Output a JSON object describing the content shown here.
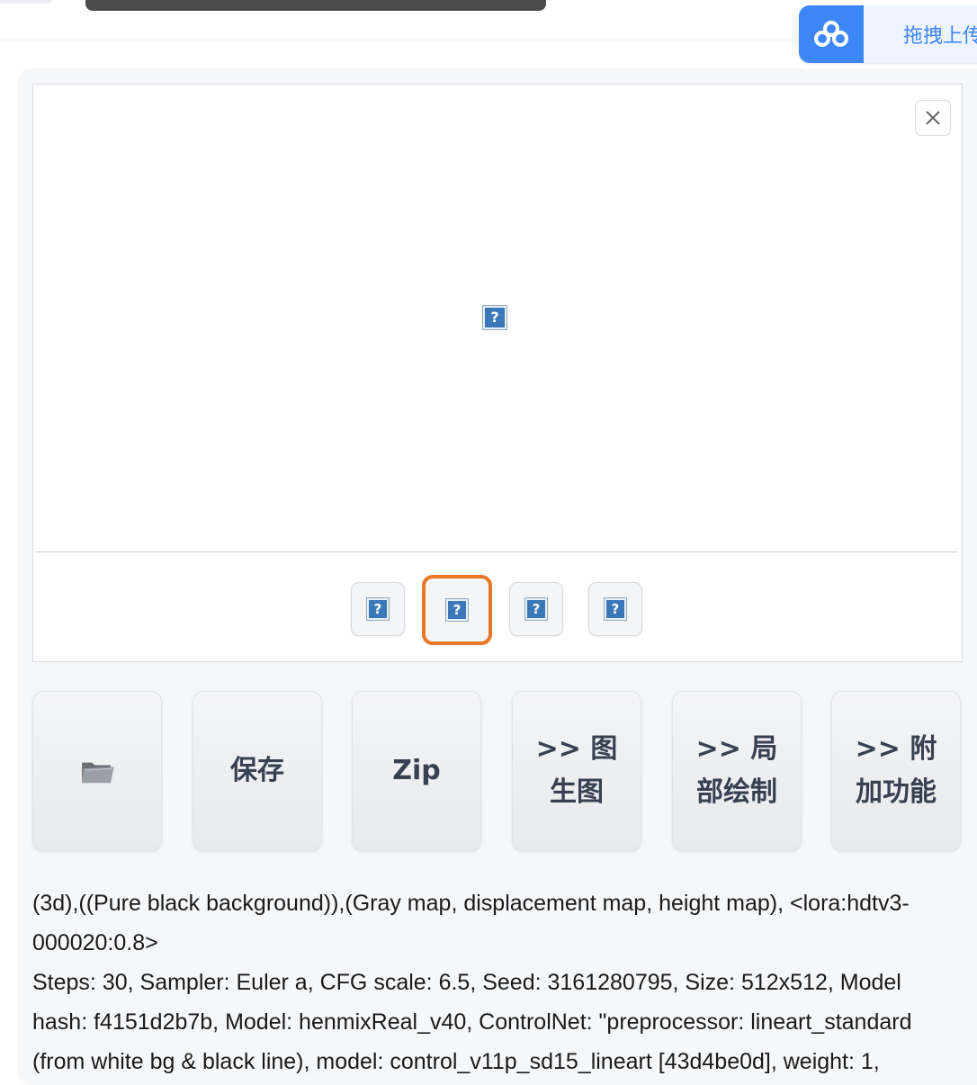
{
  "header": {
    "upload_label": "拖拽上传"
  },
  "gallery": {
    "close_icon": "close-icon",
    "main_image_icon": "broken-image-icon",
    "thumbnails": [
      {
        "icon": "broken-image-icon",
        "selected": false
      },
      {
        "icon": "broken-image-icon",
        "selected": true
      },
      {
        "icon": "broken-image-icon",
        "selected": false
      },
      {
        "icon": "broken-image-icon",
        "selected": false
      }
    ],
    "broken_glyph": "?"
  },
  "actions": {
    "folder_icon": "folder-icon",
    "save_label": "保存",
    "zip_label": "Zip",
    "img2img_label": ">> 图生图",
    "inpaint_label": ">> 局部绘制",
    "extras_label": ">> 附加功能"
  },
  "info": {
    "prompt": "(3d),((Pure black background)),(Gray map, displacement map, height map), <lora:hdtv3-000020:0.8>",
    "params": "Steps: 30, Sampler: Euler a, CFG scale: 6.5, Seed: 3161280795, Size: 512x512, Model hash: f4151d2b7b, Model: henmixReal_v40, ControlNet: \"preprocessor: lineart_standard (from white bg & black line), model: control_v11p_sd15_lineart [43d4be0d], weight: 1,"
  },
  "colors": {
    "accent_orange": "#e87625",
    "upload_blue": "#3d86f5"
  }
}
